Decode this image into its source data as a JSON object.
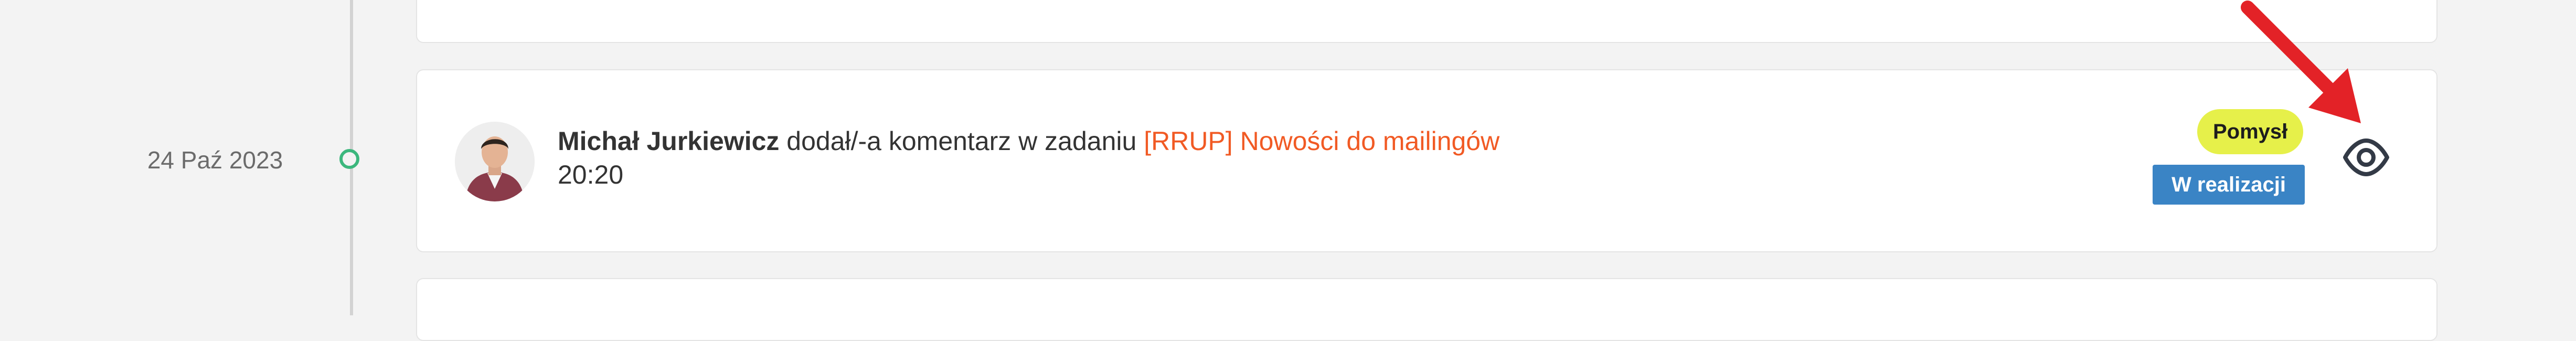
{
  "timeline": {
    "date": "24 Paź 2023"
  },
  "activity": {
    "user_name": "Michał Jurkiewicz",
    "action_text": " dodał/-a komentarz w zadaniu ",
    "task_link": "[RRUP] Nowości do mailingów",
    "time": "20:20",
    "badges": {
      "type": "Pomysł",
      "status": "W realizacji"
    },
    "view_icon": "eye-icon"
  },
  "colors": {
    "link": "#f15a24",
    "badge_type_bg": "#e6f04a",
    "badge_status_bg": "#3a84c5",
    "timeline_dot": "#3cb77d",
    "annotation_arrow": "#e32227"
  }
}
